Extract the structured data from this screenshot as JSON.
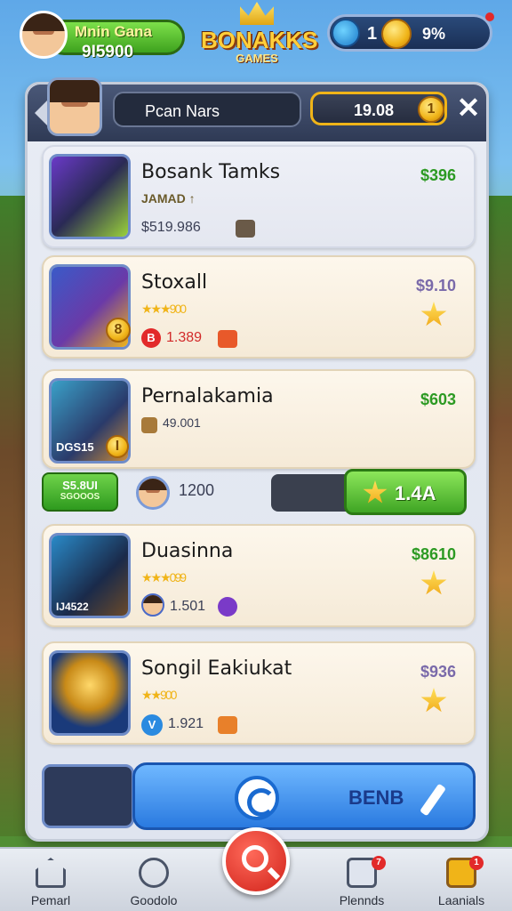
{
  "header": {
    "player_name": "Mnin Gana",
    "player_coins": "9I5900",
    "logo_line1": "BONAKKS",
    "logo_line2": "GAMES",
    "currency_a": "1",
    "currency_b": "9%"
  },
  "panel": {
    "title": "Pcan Nars",
    "score": "19.08",
    "score_badge": "1",
    "close_label": "✕"
  },
  "cards": [
    {
      "name": "Bosank Tamks",
      "meta": "JAMAD ↑",
      "sub": "$519.986",
      "price": "$396"
    },
    {
      "name": "Stoxall",
      "meta": "★★★900",
      "sub": "1.389",
      "sub_badge": "B",
      "price": "$9.10",
      "thumb_badge": "8"
    },
    {
      "name": "Pernalakamia",
      "meta": "49.001",
      "sub": "DGS15",
      "price": "$603",
      "thumb_badge": "I"
    },
    {
      "name": "Duasinna",
      "meta": "★★★099",
      "sub": "1.501",
      "thumb_text": "IJ4522",
      "price": "$8610"
    },
    {
      "name": "Songil Eakiukat",
      "meta": "★★900",
      "sub": "1.921",
      "sub_badge": "V",
      "price": "$936"
    }
  ],
  "boost_row": {
    "badge_line1": "S5.8UI",
    "badge_line2": "SGOOOS",
    "value": "1200",
    "button_label": "1.4A"
  },
  "action": {
    "label": "BENB"
  },
  "nav": [
    {
      "label": "Pemarl",
      "icon": "home-icon"
    },
    {
      "label": "Goodolo",
      "icon": "chat-icon"
    },
    {
      "label": "Plennds",
      "icon": "checklist-icon",
      "badge": "7"
    },
    {
      "label": "Laanials",
      "icon": "gift-icon",
      "badge": "1"
    }
  ],
  "colors": {
    "accent_green": "#3ea21e",
    "price_green": "#2c9a23",
    "action_blue": "#2a7ae0",
    "center_red": "#d0221a",
    "gold": "#f0b418"
  }
}
